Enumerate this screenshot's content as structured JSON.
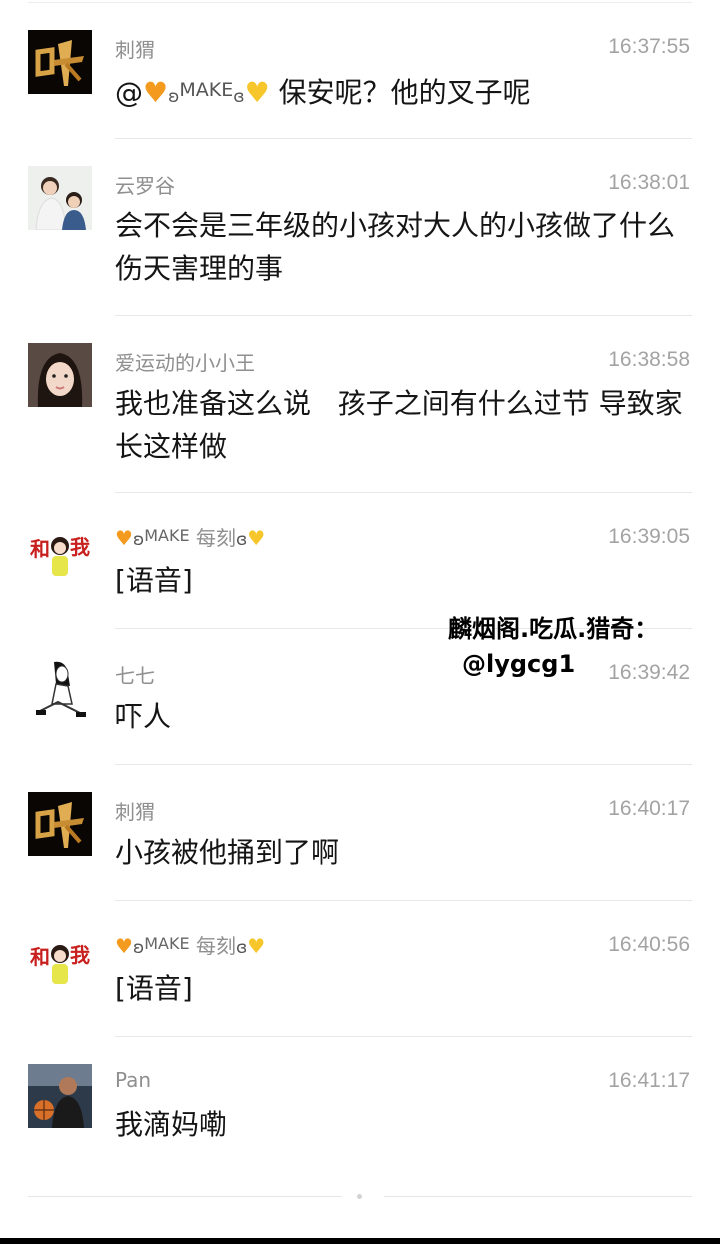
{
  "messages": [
    {
      "avatar": "calligraphy-ye-avatar",
      "sender": "刺猬",
      "time": "16:37:55",
      "text_prefix": "@",
      "mention": "MAKE",
      "text": "保安呢？他的叉子呢"
    },
    {
      "avatar": "mother-child-photo-avatar",
      "sender": "云罗谷",
      "time": "16:38:01",
      "text": "会不会是三年级的小孩对大人的小孩做了什么伤天害理的事"
    },
    {
      "avatar": "girl-portrait-avatar",
      "sender": "爱运动的小小王",
      "time": "16:38:58",
      "text": "我也准备这么说   孩子之间有什么过节 导致家长这样做"
    },
    {
      "avatar": "cartoon-girl-avatar",
      "sender_make": "MAKE",
      "sender_rest": "每刻",
      "time": "16:39:05",
      "text": "[语音]"
    },
    {
      "avatar": "sketch-girl-avatar",
      "sender": "七七",
      "time": "16:39:42",
      "text": "吓人"
    },
    {
      "avatar": "calligraphy-ye-avatar",
      "sender": "刺猬",
      "time": "16:40:17",
      "text": "小孩被他捅到了啊"
    },
    {
      "avatar": "cartoon-girl-avatar",
      "sender_make": "MAKE",
      "sender_rest": "每刻",
      "time": "16:40:56",
      "text": "[语音]"
    },
    {
      "avatar": "basketball-man-avatar",
      "sender": "Pan",
      "time": "16:41:17",
      "text": "我滴妈嘞"
    }
  ],
  "watermark": {
    "line1": "麟烟阁.吃瓜.猎奇：",
    "line2": "@lygcg1"
  },
  "colors": {
    "sender": "#8f8f8f",
    "time": "#a3a3a3",
    "text": "#151515",
    "divider": "#e8e8e8"
  }
}
